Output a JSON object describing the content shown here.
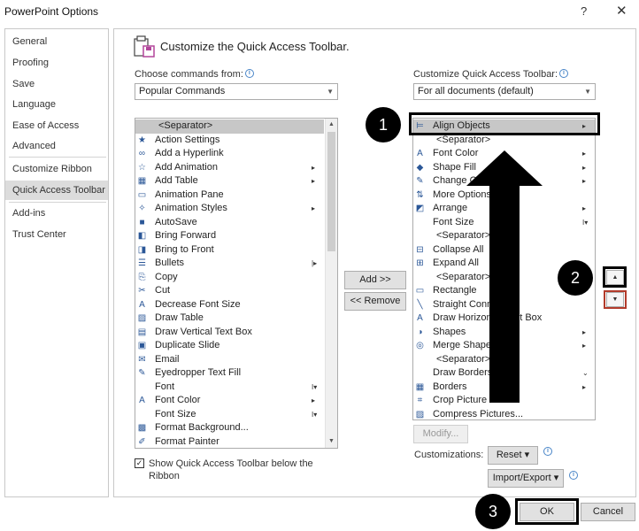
{
  "window": {
    "title": "PowerPoint Options",
    "help": "?",
    "close": "✕"
  },
  "nav": {
    "items": [
      {
        "label": "General"
      },
      {
        "label": "Proofing"
      },
      {
        "label": "Save"
      },
      {
        "label": "Language"
      },
      {
        "label": "Ease of Access"
      },
      {
        "label": "Advanced"
      },
      {
        "label": "Customize Ribbon"
      },
      {
        "label": "Quick Access Toolbar",
        "active": true
      },
      {
        "label": "Add-ins"
      },
      {
        "label": "Trust Center"
      }
    ]
  },
  "main": {
    "header": "Customize the Quick Access Toolbar.",
    "choose_label": "Choose commands from:",
    "choose_value": "Popular Commands",
    "customize_label": "Customize Quick Access Toolbar:",
    "customize_value": "For all documents (default)",
    "commands": [
      {
        "label": "<Separator>",
        "icon": "",
        "sep": true,
        "selected": true
      },
      {
        "label": "Action Settings",
        "icon": "★"
      },
      {
        "label": "Add a Hyperlink",
        "icon": "∞"
      },
      {
        "label": "Add Animation",
        "icon": "☆",
        "sub": "▸"
      },
      {
        "label": "Add Table",
        "icon": "▦",
        "sub": "▸"
      },
      {
        "label": "Animation Pane",
        "icon": "▭"
      },
      {
        "label": "Animation Styles",
        "icon": "✧",
        "sub": "▸"
      },
      {
        "label": "AutoSave",
        "icon": "■"
      },
      {
        "label": "Bring Forward",
        "icon": "◧"
      },
      {
        "label": "Bring to Front",
        "icon": "◨"
      },
      {
        "label": "Bullets",
        "icon": "☰",
        "sub": "|▸"
      },
      {
        "label": "Copy",
        "icon": "⎘"
      },
      {
        "label": "Cut",
        "icon": "✂"
      },
      {
        "label": "Decrease Font Size",
        "icon": "A"
      },
      {
        "label": "Draw Table",
        "icon": "▨"
      },
      {
        "label": "Draw Vertical Text Box",
        "icon": "▤"
      },
      {
        "label": "Duplicate Slide",
        "icon": "▣"
      },
      {
        "label": "Email",
        "icon": "✉"
      },
      {
        "label": "Eyedropper Text Fill",
        "icon": "✎"
      },
      {
        "label": "Font",
        "icon": "",
        "sub": "I▾"
      },
      {
        "label": "Font Color",
        "icon": "A",
        "sub": "▸"
      },
      {
        "label": "Font Size",
        "icon": "",
        "sub": "I▾"
      },
      {
        "label": "Format Background...",
        "icon": "▩"
      },
      {
        "label": "Format Painter",
        "icon": "✐"
      }
    ],
    "toolbar_items": [
      {
        "label": "Align Objects",
        "icon": "⊨",
        "sub": "▸",
        "selected": true
      },
      {
        "label": "<Separator>",
        "icon": "",
        "sep": true
      },
      {
        "label": "Font Color",
        "icon": "A",
        "sub": "▸"
      },
      {
        "label": "Shape Fill",
        "icon": "◆",
        "sub": "▸"
      },
      {
        "label": "Change Outline",
        "icon": "✎",
        "sub": "▸"
      },
      {
        "label": "More Options",
        "icon": "⇅"
      },
      {
        "label": "Arrange",
        "icon": "◩",
        "sub": "▸"
      },
      {
        "label": "Font Size",
        "icon": "",
        "sub": "I▾"
      },
      {
        "label": "<Separator>",
        "icon": "",
        "sep": true
      },
      {
        "label": "Collapse All",
        "icon": "⊟"
      },
      {
        "label": "Expand All",
        "icon": "⊞"
      },
      {
        "label": "<Separator>",
        "icon": "",
        "sep": true
      },
      {
        "label": "Rectangle",
        "icon": "▭"
      },
      {
        "label": "Straight Connector",
        "icon": "╲"
      },
      {
        "label": "Draw Horizontal Text Box",
        "icon": "A"
      },
      {
        "label": "Shapes",
        "icon": "◑",
        "sub": "▸"
      },
      {
        "label": "Merge Shapes",
        "icon": "◎",
        "sub": "▸"
      },
      {
        "label": "<Separator>",
        "icon": "",
        "sep": true
      },
      {
        "label": "Draw Borders",
        "icon": "",
        "sub": "⌄"
      },
      {
        "label": "Borders",
        "icon": "▦",
        "sub": "▸"
      },
      {
        "label": "Crop Picture",
        "icon": "⌗"
      },
      {
        "label": "Compress Pictures...",
        "icon": "▨"
      }
    ],
    "add_label": "Add >>",
    "remove_label": "<< Remove",
    "modify_label": "Modify...",
    "customizations_label": "Customizations:",
    "reset_label": "Reset ▾",
    "import_export_label": "Import/Export ▾",
    "show_below_label": "Show Quick Access Toolbar below the Ribbon",
    "show_below_checked": "✓"
  },
  "footer": {
    "ok": "OK",
    "cancel": "Cancel"
  },
  "callouts": [
    "1",
    "2",
    "3"
  ],
  "colors": {
    "highlight_red": "#b23b2b",
    "selection": "#c7c7c7"
  }
}
